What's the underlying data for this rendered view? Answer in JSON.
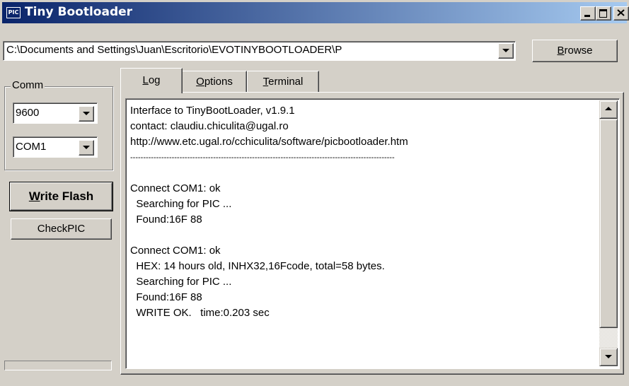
{
  "window": {
    "icon_text": "PIC",
    "title": "Tiny Bootloader"
  },
  "file": {
    "path": "C:\\Documents and Settings\\Juan\\Escritorio\\EVOTINYBOOTLOADER\\P",
    "browse_label_prefix": "",
    "browse_accel": "B",
    "browse_label_rest": "rowse"
  },
  "comm": {
    "group_label": "Comm",
    "baud": "9600",
    "port": "COM1"
  },
  "buttons": {
    "write_accel": "W",
    "write_rest": "rite Flash",
    "checkpic": "CheckPIC"
  },
  "progress": {
    "value": 0
  },
  "tabs": [
    {
      "accel": "L",
      "rest": "og"
    },
    {
      "accel": "O",
      "rest": "ptions"
    },
    {
      "accel": "T",
      "rest": "erminal"
    }
  ],
  "log": [
    "Interface to TinyBootLoader, v1.9.1",
    "contact: claudiu.chiculita@ugal.ro",
    "http://www.etc.ugal.ro/cchiculita/software/picbootloader.htm",
    "------------------------------------------------------------------------------------------------------",
    "",
    "Connect COM1: ok",
    "  Searching for PIC ...",
    "  Found:16F 88",
    "",
    "Connect COM1: ok",
    "  HEX: 14 hours old, INHX32,16Fcode, total=58 bytes.",
    "  Searching for PIC ...",
    "  Found:16F 88",
    "  WRITE OK.   time:0.203 sec"
  ]
}
